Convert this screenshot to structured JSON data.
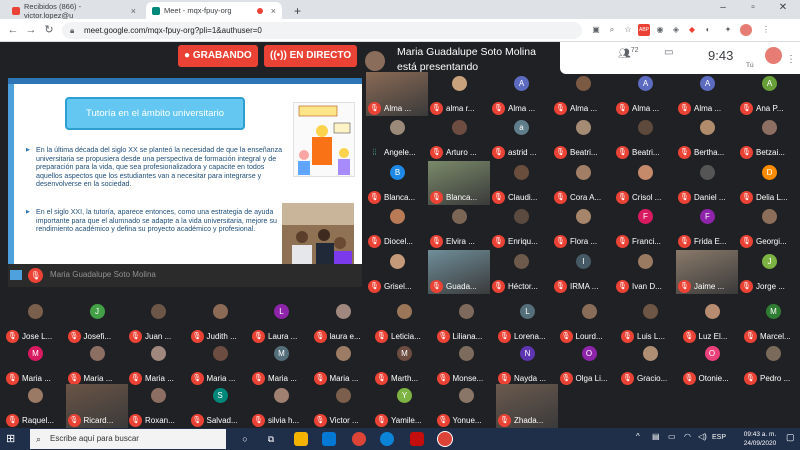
{
  "browser": {
    "tabs": [
      {
        "label": "Recibidos (866) - victor.lopez@u",
        "favicon": "gmail-icon"
      },
      {
        "label": "Meet - mqx-fpuy-org",
        "favicon": "meet-icon"
      }
    ],
    "new_tab": "+",
    "url": "meet.google.com/mqx-fpuy-org?pli=1&authuser=0"
  },
  "meet": {
    "recording_label": "GRABANDO",
    "live_label": "EN DIRECTO",
    "presenting_text": "Maria Guadalupe Soto Molina está presentando",
    "participant_count": "72",
    "clock": "9:43",
    "self_label": "Tú"
  },
  "slide": {
    "title": "Tutoría en el ámbito universitario",
    "bullets": [
      "En la última década del siglo XX se planteó la necesidad de que la enseñanza universitaria se propusiera desde una perspectiva de formación integral y de preparación para la vida, que sea profesionalizadora y capacite en todos aquellos aspectos que los estudiantes van a necesitar para integrarse y desenvolverse en la sociedad.",
      "En el siglo XXI, la tutoría, aparece entonces, como una estrategia de ayuda importante para que el alumnado se adapte a la vida universitaria, mejore su rendimiento académico y defina su proyecto académico y profesional."
    ],
    "presenter_name": "Maria Guadalupe Soto Molina"
  },
  "participants": [
    {
      "name": "Alma ...",
      "initial": "",
      "color": "#8a6a55",
      "mic": "off",
      "photo": true
    },
    {
      "name": "alma r...",
      "initial": "",
      "color": "#c7a27c",
      "mic": "off",
      "photo": false
    },
    {
      "name": "Alma ...",
      "initial": "A",
      "color": "#5c6bc0",
      "mic": "off",
      "photo": false
    },
    {
      "name": "Alma ...",
      "initial": "",
      "color": "#7b5a44",
      "mic": "off",
      "photo": false
    },
    {
      "name": "Alma ...",
      "initial": "A",
      "color": "#5c6bc0",
      "mic": "off",
      "photo": false
    },
    {
      "name": "Alma ...",
      "initial": "A",
      "color": "#5c6bc0",
      "mic": "off",
      "photo": false
    },
    {
      "name": "Ana P...",
      "initial": "A",
      "color": "#689f38",
      "mic": "off",
      "photo": false
    },
    {
      "name": "Angele...",
      "initial": "",
      "color": "#9b8a7a",
      "mic": "on",
      "photo": false
    },
    {
      "name": "Arturo ...",
      "initial": "",
      "color": "#6d4c41",
      "mic": "off",
      "photo": false
    },
    {
      "name": "astrid ...",
      "initial": "a",
      "color": "#607d8b",
      "mic": "off",
      "photo": false
    },
    {
      "name": "Beatri...",
      "initial": "",
      "color": "#a58b74",
      "mic": "off",
      "photo": false
    },
    {
      "name": "Beatri...",
      "initial": "",
      "color": "#5e4a3c",
      "mic": "off",
      "photo": false
    },
    {
      "name": "Bertha...",
      "initial": "",
      "color": "#b08c6c",
      "mic": "off",
      "photo": false
    },
    {
      "name": "Betzai...",
      "initial": "",
      "color": "#8d6e63",
      "mic": "off",
      "photo": false
    },
    {
      "name": "Blanca...",
      "initial": "B",
      "color": "#1e88e5",
      "mic": "off",
      "photo": false
    },
    {
      "name": "Blanca...",
      "initial": "",
      "color": "#7a8a6a",
      "mic": "off",
      "photo": true
    },
    {
      "name": "Claudi...",
      "initial": "",
      "color": "#6a4e3d",
      "mic": "off",
      "photo": false
    },
    {
      "name": "Cora A...",
      "initial": "",
      "color": "#a07f66",
      "mic": "off",
      "photo": false
    },
    {
      "name": "Crisol ...",
      "initial": "",
      "color": "#c48a6a",
      "mic": "off",
      "photo": false
    },
    {
      "name": "Daniel ...",
      "initial": "",
      "color": "#555555",
      "mic": "off",
      "photo": false
    },
    {
      "name": "Delia L...",
      "initial": "D",
      "color": "#fb8c00",
      "mic": "off",
      "photo": false
    },
    {
      "name": "Diocel...",
      "initial": "",
      "color": "#b97a56",
      "mic": "off",
      "photo": false
    },
    {
      "name": "Elvira ...",
      "initial": "",
      "color": "#7b6656",
      "mic": "off",
      "photo": false
    },
    {
      "name": "Enriqu...",
      "initial": "",
      "color": "#5b4a3f",
      "mic": "off",
      "photo": false
    },
    {
      "name": "Flora ...",
      "initial": "",
      "color": "#a6856a",
      "mic": "off",
      "photo": false
    },
    {
      "name": "Franci...",
      "initial": "F",
      "color": "#d81b60",
      "mic": "off",
      "photo": false
    },
    {
      "name": "Frida E...",
      "initial": "F",
      "color": "#8e24aa",
      "mic": "off",
      "photo": false
    },
    {
      "name": "Georgi...",
      "initial": "",
      "color": "#8c6e5a",
      "mic": "off",
      "photo": false
    },
    {
      "name": "Grisel...",
      "initial": "",
      "color": "#c49a7a",
      "mic": "off",
      "photo": false
    },
    {
      "name": "Guada...",
      "initial": "",
      "color": "#6f8e9a",
      "mic": "off",
      "photo": true
    },
    {
      "name": "Héctor...",
      "initial": "",
      "color": "#6d5a4b",
      "mic": "off",
      "photo": false
    },
    {
      "name": "IRMA ...",
      "initial": "I",
      "color": "#455a64",
      "mic": "off",
      "photo": false
    },
    {
      "name": "Ivan D...",
      "initial": "",
      "color": "#9a7b62",
      "mic": "off",
      "photo": false
    },
    {
      "name": "Jaime ...",
      "initial": "",
      "color": "#8a7a6a",
      "mic": "off",
      "photo": true
    },
    {
      "name": "Jorge ...",
      "initial": "J",
      "color": "#7cb342",
      "mic": "off",
      "photo": false
    },
    {
      "name": "Jose L...",
      "initial": "",
      "color": "#7a5f4c",
      "mic": "off",
      "photo": false
    },
    {
      "name": "Josefi...",
      "initial": "J",
      "color": "#43a047",
      "mic": "off",
      "photo": false
    },
    {
      "name": "Juan ...",
      "initial": "",
      "color": "#6b5647",
      "mic": "off",
      "photo": false
    },
    {
      "name": "Judith ...",
      "initial": "",
      "color": "#8b6b56",
      "mic": "off",
      "photo": false
    },
    {
      "name": "Laura ...",
      "initial": "L",
      "color": "#8e24aa",
      "mic": "off",
      "photo": false
    },
    {
      "name": "laura e...",
      "initial": "",
      "color": "#a1887f",
      "mic": "off",
      "photo": false
    },
    {
      "name": "Leticia...",
      "initial": "",
      "color": "#9b7659",
      "mic": "off",
      "photo": false
    },
    {
      "name": "Liliana...",
      "initial": "",
      "color": "#7e6a5c",
      "mic": "off",
      "photo": false
    },
    {
      "name": "Lorena...",
      "initial": "L",
      "color": "#546e7a",
      "mic": "off",
      "photo": false
    },
    {
      "name": "Lourd...",
      "initial": "",
      "color": "#8a6d58",
      "mic": "off",
      "photo": false
    },
    {
      "name": "Luis L...",
      "initial": "",
      "color": "#6e5646",
      "mic": "off",
      "photo": false
    },
    {
      "name": "Luz El...",
      "initial": "",
      "color": "#b78c70",
      "mic": "off",
      "photo": false
    },
    {
      "name": "Marcel...",
      "initial": "M",
      "color": "#2e7d32",
      "mic": "off",
      "photo": false
    },
    {
      "name": "Maria ...",
      "initial": "M",
      "color": "#d81b60",
      "mic": "off",
      "photo": false
    },
    {
      "name": "Maria ...",
      "initial": "",
      "color": "#8d6e63",
      "mic": "off",
      "photo": false
    },
    {
      "name": "Maria ...",
      "initial": "",
      "color": "#a1887f",
      "mic": "off",
      "photo": false
    },
    {
      "name": "Maria ...",
      "initial": "",
      "color": "#6d4c41",
      "mic": "off",
      "photo": false
    },
    {
      "name": "Maria ...",
      "initial": "M",
      "color": "#546e7a",
      "mic": "off",
      "photo": false
    },
    {
      "name": "Maria ...",
      "initial": "",
      "color": "#9c7c64",
      "mic": "off",
      "photo": false
    },
    {
      "name": "Marth...",
      "initial": "M",
      "color": "#6d4c41",
      "mic": "off",
      "photo": false
    },
    {
      "name": "Monse...",
      "initial": "",
      "color": "#7d6b5e",
      "mic": "off",
      "photo": false
    },
    {
      "name": "Nayda ...",
      "initial": "N",
      "color": "#5e35b1",
      "mic": "off",
      "photo": false
    },
    {
      "name": "Olga Li...",
      "initial": "O",
      "color": "#8e24aa",
      "mic": "off",
      "photo": false
    },
    {
      "name": "Gracio...",
      "initial": "",
      "color": "#b08e74",
      "mic": "off",
      "photo": false
    },
    {
      "name": "Otonie...",
      "initial": "O",
      "color": "#ec407a",
      "mic": "off",
      "photo": false
    },
    {
      "name": "Pedro ...",
      "initial": "",
      "color": "#7a6a5a",
      "mic": "off",
      "photo": false
    },
    {
      "name": "Raquel...",
      "initial": "",
      "color": "#9a7a64",
      "mic": "off",
      "photo": false
    },
    {
      "name": "Ricard...",
      "initial": "",
      "color": "#6a5446",
      "mic": "off",
      "photo": true
    },
    {
      "name": "Roxan...",
      "initial": "",
      "color": "#8d6e63",
      "mic": "off",
      "photo": false
    },
    {
      "name": "Salvad...",
      "initial": "S",
      "color": "#00897b",
      "mic": "off",
      "photo": false
    },
    {
      "name": "silvia h...",
      "initial": "",
      "color": "#a08070",
      "mic": "off",
      "photo": false
    },
    {
      "name": "Victor ...",
      "initial": "",
      "color": "#7b5e4c",
      "mic": "off",
      "photo": false
    },
    {
      "name": "Yamile...",
      "initial": "Y",
      "color": "#7cb342",
      "mic": "off",
      "photo": false
    },
    {
      "name": "Yonue...",
      "initial": "",
      "color": "#8a7666",
      "mic": "off",
      "photo": false
    },
    {
      "name": "Zhada...",
      "initial": "",
      "color": "#6b5a4e",
      "mic": "off",
      "photo": true
    }
  ],
  "taskbar": {
    "search_placeholder": "Escribe aquí para buscar",
    "language": "ESP",
    "time": "09:43 a. m.",
    "date": "24/09/2020"
  }
}
